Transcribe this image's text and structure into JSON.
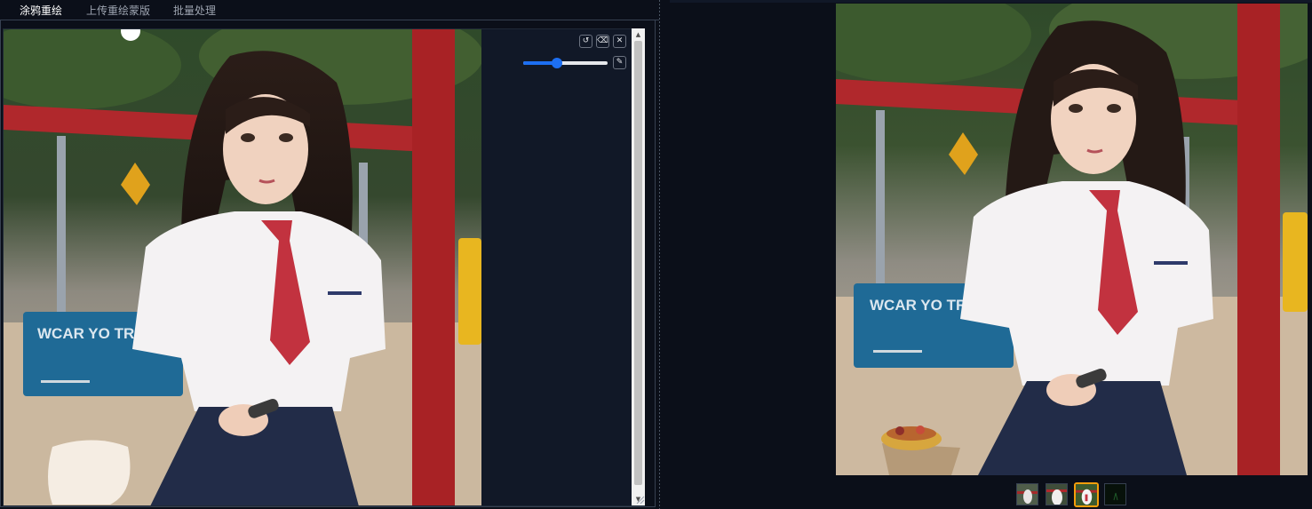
{
  "tabs": [
    {
      "label": "涂鸦重绘",
      "active": true
    },
    {
      "label": "上传重绘蒙版",
      "active": false
    },
    {
      "label": "批量处理",
      "active": false
    }
  ],
  "canvas_image": {
    "sign_text": "WCAR YO TRE",
    "description_icon": "image-canvas"
  },
  "canvas_toolbar": {
    "undo_icon": "undo-icon",
    "clear_icon": "eraser-icon",
    "close_icon": "close-icon",
    "brush_icon": "brush-icon"
  },
  "brush_size": 0.4,
  "result_image": {
    "sign_text": "WCAR YO TRE"
  },
  "gallery": {
    "thumbnails": [
      "thumbnail-1",
      "thumbnail-2",
      "thumbnail-3",
      "thumbnail-4"
    ],
    "selected_index": 2
  },
  "colors": {
    "accent": "#1d6ff2",
    "selected_border": "#f59e0b",
    "background": "#0b0f19"
  }
}
